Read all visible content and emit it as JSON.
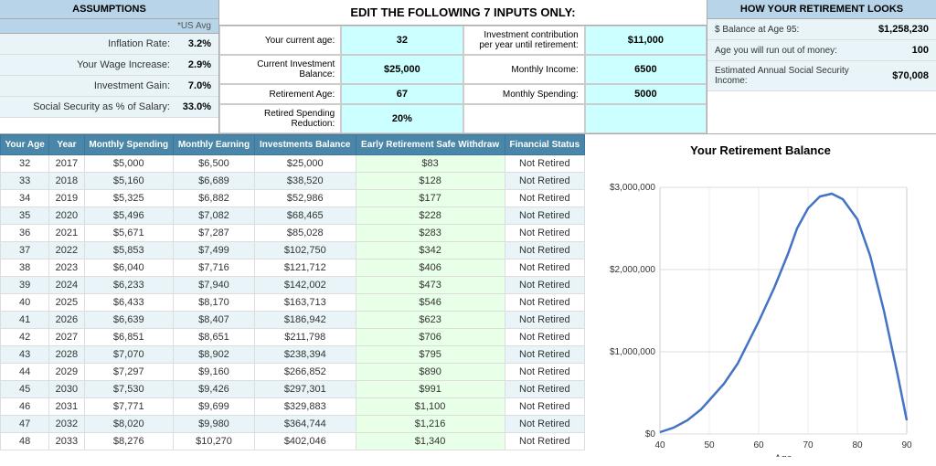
{
  "assumptions": {
    "header": "ASSUMPTIONS",
    "subheader": "*US Avg",
    "rows": [
      {
        "label": "Inflation Rate:",
        "value": "3.2%"
      },
      {
        "label": "Your Wage Increase:",
        "value": "2.9%"
      },
      {
        "label": "Investment Gain:",
        "value": "7.0%"
      },
      {
        "label": "Social Security as % of Salary:",
        "value": "33.0%"
      }
    ]
  },
  "inputs": {
    "header": "EDIT THE FOLLOWING 7 INPUTS ONLY:",
    "fields": [
      {
        "label": "Your current age:",
        "value": "32"
      },
      {
        "label": "Current Investment Balance:",
        "value": "$25,000"
      },
      {
        "label": "Retirement Age:",
        "value": "67"
      },
      {
        "label": "Retired Spending Reduction:",
        "value": "20%"
      },
      {
        "label": "Investment contribution per year until retirement:",
        "value": "$11,000"
      },
      {
        "label": "Monthly Income:",
        "value": "6500"
      },
      {
        "label": "Monthly Spending:",
        "value": "5000"
      }
    ]
  },
  "looks": {
    "header": "HOW YOUR RETIREMENT LOOKS",
    "rows": [
      {
        "label": "$ Balance at Age 95:",
        "value": "$1,258,230"
      },
      {
        "label": "Age you will run out of money:",
        "value": "100"
      },
      {
        "label": "Estimated Annual Social Security Income:",
        "value": "$70,008"
      }
    ]
  },
  "table": {
    "headers": [
      "Your Age",
      "Year",
      "Monthly Spending",
      "Monthly Earning",
      "Investments Balance",
      "Early Retirement Safe Withdraw",
      "Financial Status"
    ],
    "rows": [
      [
        "32",
        "2017",
        "$5,000",
        "$6,500",
        "$25,000",
        "$83",
        "Not Retired"
      ],
      [
        "33",
        "2018",
        "$5,160",
        "$6,689",
        "$38,520",
        "$128",
        "Not Retired"
      ],
      [
        "34",
        "2019",
        "$5,325",
        "$6,882",
        "$52,986",
        "$177",
        "Not Retired"
      ],
      [
        "35",
        "2020",
        "$5,496",
        "$7,082",
        "$68,465",
        "$228",
        "Not Retired"
      ],
      [
        "36",
        "2021",
        "$5,671",
        "$7,287",
        "$85,028",
        "$283",
        "Not Retired"
      ],
      [
        "37",
        "2022",
        "$5,853",
        "$7,499",
        "$102,750",
        "$342",
        "Not Retired"
      ],
      [
        "38",
        "2023",
        "$6,040",
        "$7,716",
        "$121,712",
        "$406",
        "Not Retired"
      ],
      [
        "39",
        "2024",
        "$6,233",
        "$7,940",
        "$142,002",
        "$473",
        "Not Retired"
      ],
      [
        "40",
        "2025",
        "$6,433",
        "$8,170",
        "$163,713",
        "$546",
        "Not Retired"
      ],
      [
        "41",
        "2026",
        "$6,639",
        "$8,407",
        "$186,942",
        "$623",
        "Not Retired"
      ],
      [
        "42",
        "2027",
        "$6,851",
        "$8,651",
        "$211,798",
        "$706",
        "Not Retired"
      ],
      [
        "43",
        "2028",
        "$7,070",
        "$8,902",
        "$238,394",
        "$795",
        "Not Retired"
      ],
      [
        "44",
        "2029",
        "$7,297",
        "$9,160",
        "$266,852",
        "$890",
        "Not Retired"
      ],
      [
        "45",
        "2030",
        "$7,530",
        "$9,426",
        "$297,301",
        "$991",
        "Not Retired"
      ],
      [
        "46",
        "2031",
        "$7,771",
        "$9,699",
        "$329,883",
        "$1,100",
        "Not Retired"
      ],
      [
        "47",
        "2032",
        "$8,020",
        "$9,980",
        "$364,744",
        "$1,216",
        "Not Retired"
      ],
      [
        "48",
        "2033",
        "$8,276",
        "$10,270",
        "$402,046",
        "$1,340",
        "Not Retired"
      ]
    ]
  },
  "chart": {
    "title": "Your Retirement Balance",
    "y_labels": [
      "$3,000,000",
      "$2,000,000",
      "$1,000,000",
      "$0"
    ],
    "x_labels": [
      "40",
      "50",
      "60",
      "70",
      "80"
    ],
    "x_axis_label": "Age"
  }
}
